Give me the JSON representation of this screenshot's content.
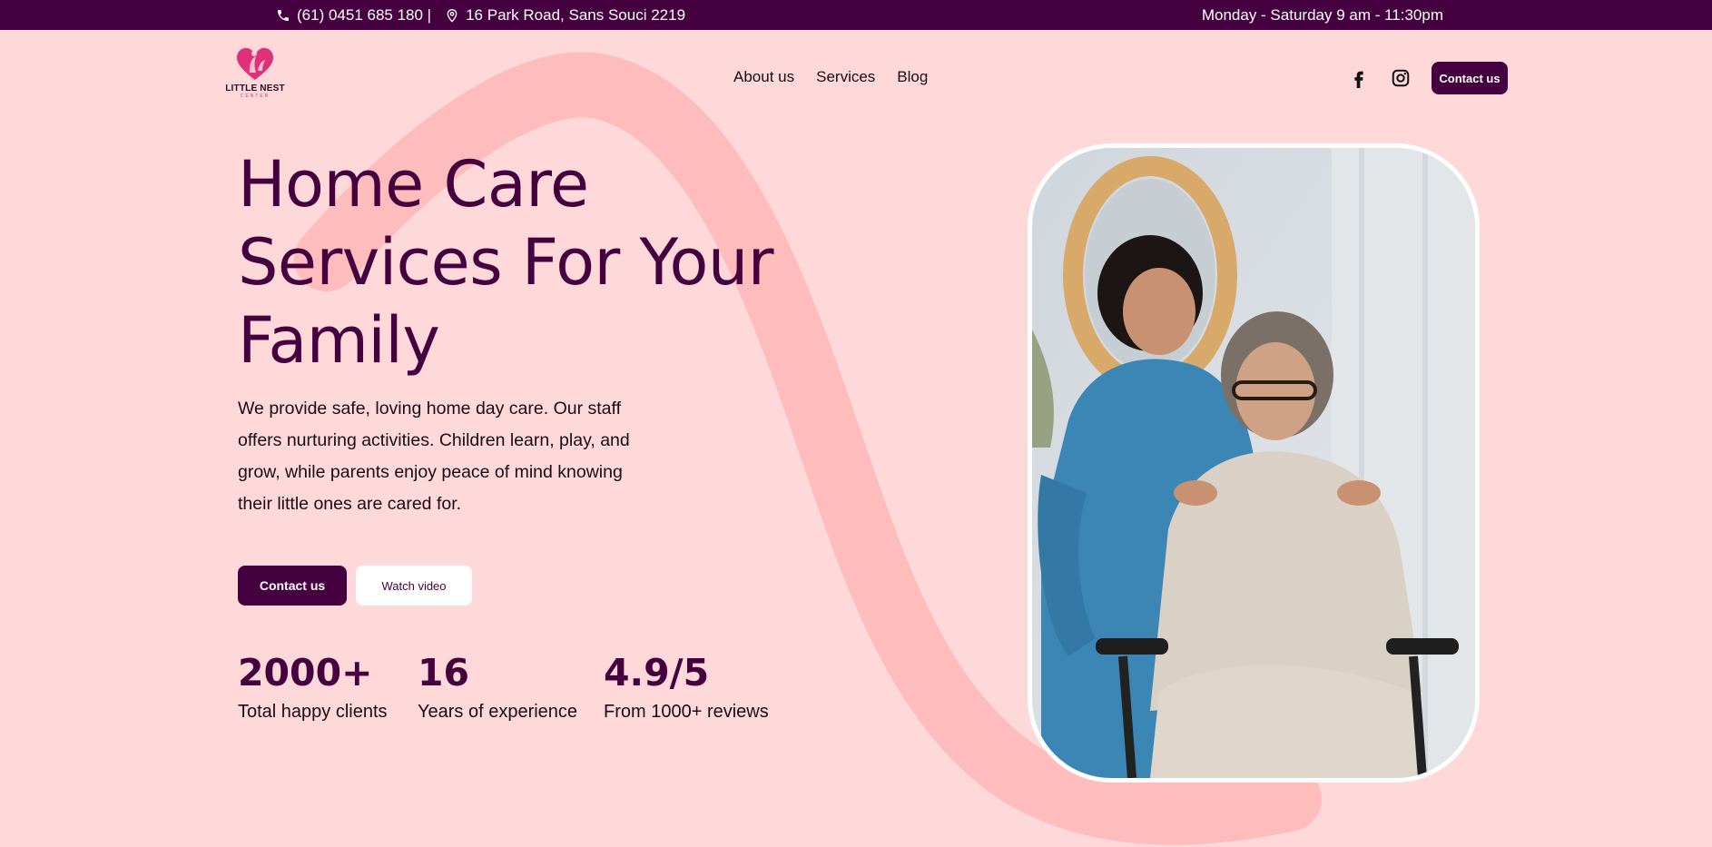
{
  "topbar": {
    "phone": "(61) 0451 685 180 |",
    "address": "16 Park Road, Sans Souci 2219",
    "hours": "Monday - Saturday 9 am - 11:30pm",
    "phone_icon": "phone-icon",
    "location_icon": "location-pin-icon"
  },
  "logo": {
    "name": "LITTLE NEST",
    "sub": "CENTER"
  },
  "nav": {
    "items": [
      "About us",
      "Services",
      "Blog"
    ]
  },
  "header": {
    "social": [
      "facebook-icon",
      "instagram-icon"
    ],
    "contact_label": "Contact us"
  },
  "hero": {
    "title_lines": [
      "Home Care",
      "Services For Your",
      "Family"
    ],
    "description": "We provide safe, loving home day care. Our staff offers nurturing activities. Children learn, play, and grow, while parents enjoy peace of mind knowing their little ones are cared for.",
    "primary_label": "Contact us",
    "secondary_label": "Watch video"
  },
  "stats": [
    {
      "value": "2000+",
      "label": "Total happy clients"
    },
    {
      "value": "16",
      "label": "Years of experience"
    },
    {
      "value": "4.9/5",
      "label": "From 1000+ reviews"
    }
  ],
  "colors": {
    "background": "#ffd9d9",
    "brand": "#45003f",
    "swoosh": "#ffbcbc",
    "accent": "#e0307a"
  }
}
